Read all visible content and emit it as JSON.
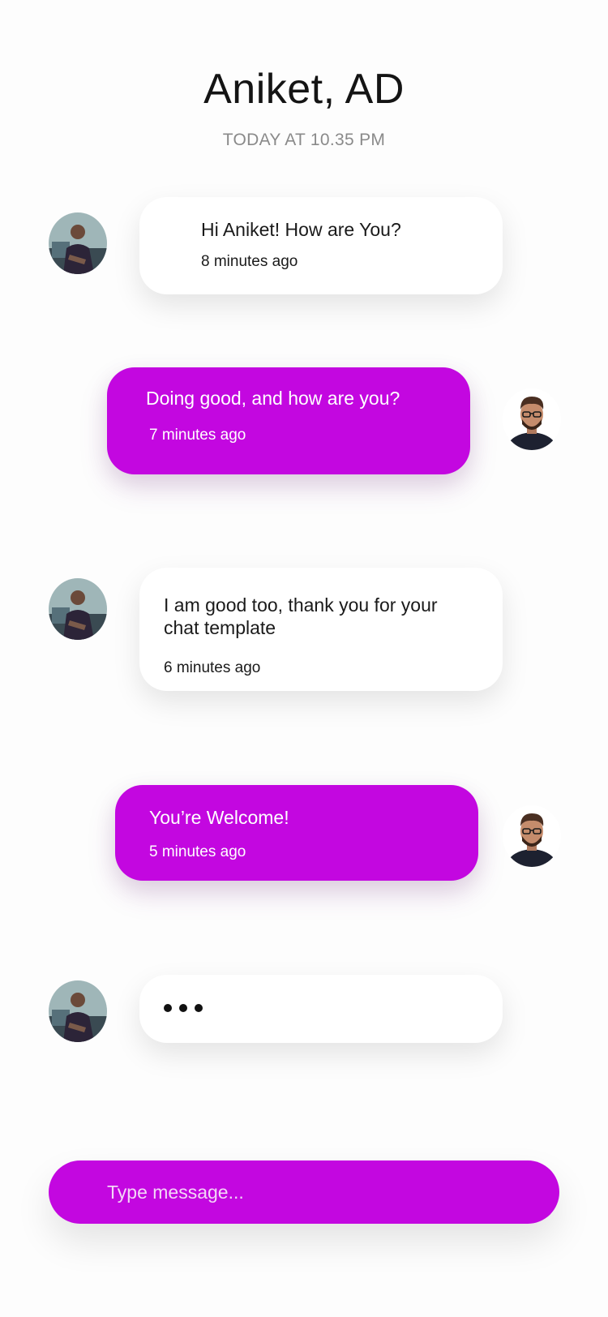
{
  "header": {
    "title": "Aniket, AD",
    "subtitle": "TODAY AT 10.35 PM"
  },
  "messages": [
    {
      "direction": "incoming",
      "text": "Hi Aniket! How are You?",
      "time": "8 minutes ago",
      "avatar": "contact-avatar"
    },
    {
      "direction": "outgoing",
      "text": "Doing good, and how are you?",
      "time": "7 minutes ago",
      "avatar": "user-avatar"
    },
    {
      "direction": "incoming",
      "text": "I am good too, thank you for your chat template",
      "time": "6 minutes ago",
      "avatar": "contact-avatar"
    },
    {
      "direction": "outgoing",
      "text": "You’re Welcome!",
      "time": "5 minutes ago",
      "avatar": "user-avatar"
    }
  ],
  "typing_indicator": {
    "avatar": "contact-avatar",
    "icon": "typing-dots-icon"
  },
  "composer": {
    "placeholder": "Type message..."
  },
  "colors": {
    "accent": "#c307e0",
    "background": "#fdfdfd",
    "incoming_bubble": "#ffffff",
    "title": "#141414",
    "subtitle": "#8a8a8a"
  }
}
